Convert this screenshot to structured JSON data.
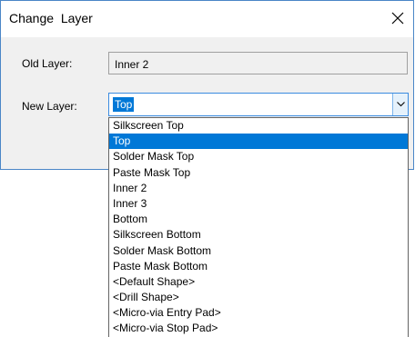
{
  "window": {
    "title": "Change  Layer",
    "close_icon": "close-icon"
  },
  "old_layer": {
    "label": "Old Layer:",
    "value": "Inner 2"
  },
  "new_layer": {
    "label": "New Layer:",
    "value": "Top",
    "dropdown_icon": "chevron-down-icon"
  },
  "dropdown": {
    "options": [
      "Silkscreen Top",
      "Top",
      "Solder Mask Top",
      "Paste Mask Top",
      "Inner 2",
      "Inner 3",
      "Bottom",
      "Silkscreen Bottom",
      "Solder Mask Bottom",
      "Paste Mask Bottom",
      "<Default Shape>",
      "<Drill Shape>",
      "<Micro-via Entry Pad>",
      "<Micro-via Stop Pad>"
    ],
    "selected_index": 1
  },
  "colors": {
    "selection": "#0078d7",
    "window_border": "#4a86c7",
    "dialog_bg": "#f0f0f0"
  }
}
